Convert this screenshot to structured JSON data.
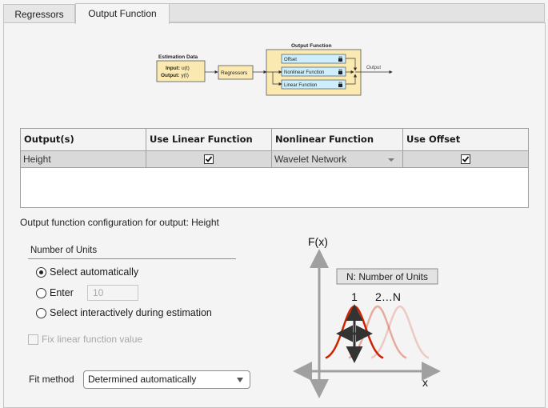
{
  "tabs": [
    {
      "label": "Regressors",
      "active": false
    },
    {
      "label": "Output Function",
      "active": true
    }
  ],
  "diagram": {
    "estimation_data_title": "Estimation Data",
    "input_label": "Input:",
    "input_value": "u(t)",
    "output_label": "Output:",
    "output_value": "y(t)",
    "regressors": "Regressors",
    "output_function_title": "Output Function",
    "blocks": [
      "Offset",
      "Nonlinear Function",
      "Linear Function"
    ],
    "output_arrow_label": "Output",
    "colors": {
      "yellow": "#fbe9b2",
      "blue": "#cdeefc",
      "border": "#555555"
    }
  },
  "table": {
    "headers": [
      "Output(s)",
      "Use Linear Function",
      "Nonlinear Function",
      "Use Offset"
    ],
    "rows": [
      {
        "output": "Height",
        "use_linear": true,
        "nonlinear": "Wavelet Network",
        "use_offset": true
      }
    ]
  },
  "config_label": "Output function configuration for output: Height",
  "units_group": {
    "title": "Number of Units",
    "options": [
      {
        "label": "Select automatically",
        "selected": true
      },
      {
        "label": "Enter",
        "selected": false
      },
      {
        "label": "Select interactively during estimation",
        "selected": false
      }
    ],
    "enter_value": "10"
  },
  "fix_linear": {
    "label": "Fix linear function value",
    "checked": false,
    "enabled": false
  },
  "fit_method": {
    "label": "Fit method",
    "value": "Determined automatically"
  },
  "illustration": {
    "y_axis_label": "F(x)",
    "x_axis_label": "x",
    "legend_box": "N: Number of Units",
    "unit_first": "1",
    "unit_rest": "2…N",
    "colors": {
      "curve": "#cc2200",
      "axis": "#a0a0a0",
      "arrows": "#333333"
    }
  }
}
